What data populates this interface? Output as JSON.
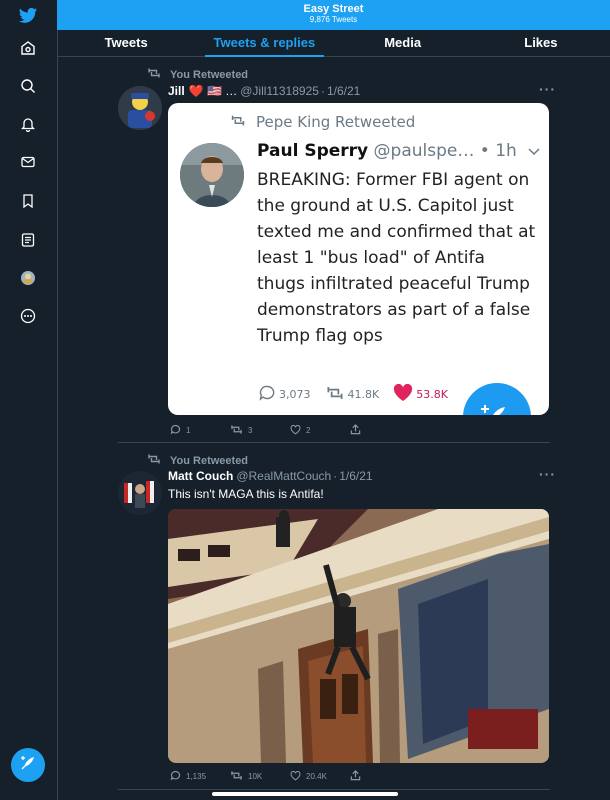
{
  "header": {
    "title": "Easy Street",
    "subtitle": "9,876 Tweets"
  },
  "tabs": [
    {
      "label": "Tweets",
      "active": false
    },
    {
      "label": "Tweets & replies",
      "active": true
    },
    {
      "label": "Media",
      "active": false
    },
    {
      "label": "Likes",
      "active": false
    }
  ],
  "sidebar": {
    "icons": [
      "twitter-bird-icon",
      "home-icon",
      "search-icon",
      "notifications-bell-icon",
      "messages-mail-icon",
      "bookmark-icon",
      "lists-icon",
      "profile-avatar-icon",
      "more-circle-icon"
    ],
    "compose_icon": "compose-tweet-icon"
  },
  "tweets": [
    {
      "retweet_label": "You Retweeted",
      "name": "Jill",
      "name_extras": "❤️ 🇺🇸 …",
      "handle": "@Jill11318925",
      "date": "1/6/21",
      "embed": {
        "retweet_label": "Pepe King Retweeted",
        "name": "Paul Sperry",
        "handle": "@paulspe…",
        "time": "• 1h",
        "text": "BREAKING: Former FBI agent on the ground at U.S. Capitol just texted me and confirmed that at least 1 \"bus load\" of Antifa thugs infiltrated peaceful Trump demonstrators as part of a false Trump flag ops",
        "replies": "3,073",
        "retweets": "41.8K",
        "likes": "53.8K"
      },
      "replies": "1",
      "retweets": "3",
      "likes": "2"
    },
    {
      "retweet_label": "You Retweeted",
      "name": "Matt Couch",
      "handle": "@RealMattCouch",
      "date": "1/6/21",
      "text": "This isn't MAGA this is Antifa!",
      "replies": "1,135",
      "retweets": "10K",
      "likes": "20.4K"
    }
  ],
  "colors": {
    "accent": "#1da1f2",
    "background": "#15202b",
    "muted": "#8899a6",
    "like": "#e0245e"
  }
}
